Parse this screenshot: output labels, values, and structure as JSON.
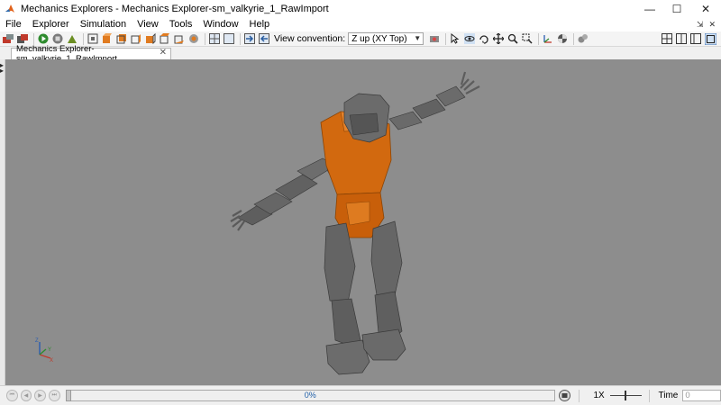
{
  "window": {
    "title": "Mechanics Explorers - Mechanics Explorer-sm_valkyrie_1_RawImport",
    "minimize": "—",
    "maximize": "☐",
    "close": "✕"
  },
  "menu": {
    "items": [
      "File",
      "Explorer",
      "Simulation",
      "View",
      "Tools",
      "Window",
      "Help"
    ],
    "dock_glyph": "⇲",
    "close_glyph": "✕"
  },
  "toolbar": {
    "view_convention_label": "View convention:",
    "view_convention_value": "Z up (XY Top)"
  },
  "tab": {
    "label": "Mechanics Explorer-sm_valkyrie_1_RawImport",
    "close": "✕"
  },
  "viewport": {
    "background": "#8d8d8d",
    "body_color": "#6b6b6b",
    "torso_color": "#d2690f",
    "triad_labels": {
      "x": "X",
      "y": "Y",
      "z": "Z"
    }
  },
  "playback": {
    "progress_text": "0%",
    "progress_value": 0,
    "speed": "1X",
    "time_label": "Time",
    "time_value": "0"
  }
}
